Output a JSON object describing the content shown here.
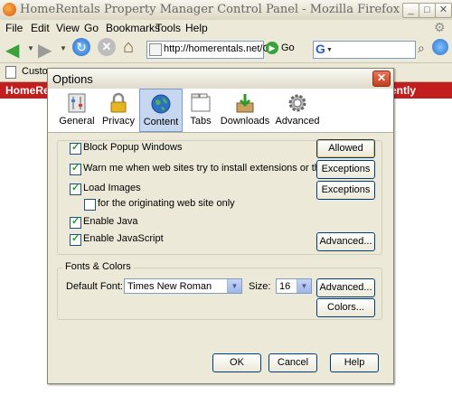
{
  "window": {
    "title": "HomeRentals Property Manager Control Panel - Mozilla Firefox",
    "min": "_",
    "max": "□",
    "close": "✕"
  },
  "menu": [
    "File",
    "Edit",
    "View",
    "Go",
    "Bookmarks",
    "Tools",
    "Help"
  ],
  "nav": {
    "url": "http://homerentals.net/Cor",
    "go_label": "Go",
    "search_value": ""
  },
  "bookmarks": {
    "item": "Custom"
  },
  "page": {
    "brand": "HomeRental",
    "logged_text": "ently logged"
  },
  "dialog": {
    "title": "Options",
    "close": "✕",
    "tabs": [
      {
        "label": "General",
        "icon": "general-sliders-icon"
      },
      {
        "label": "Privacy",
        "icon": "padlock-icon"
      },
      {
        "label": "Content",
        "icon": "globe-icon",
        "selected": true
      },
      {
        "label": "Tabs",
        "icon": "tabs-window-icon"
      },
      {
        "label": "Downloads",
        "icon": "download-box-icon"
      },
      {
        "label": "Advanced",
        "icon": "gear-icon"
      }
    ],
    "content": {
      "block_popups": "Block Popup Windows",
      "warn_extensions": "Warn me when web sites try to install extensions or themes",
      "load_images": "Load Images",
      "originating_only": "for the originating web site only",
      "enable_java": "Enable Java",
      "enable_js": "Enable JavaScript",
      "allowed_sites_btn": "Allowed Sites",
      "exceptions_btn_1": "Exceptions",
      "exceptions_btn_2": "Exceptions",
      "advanced_js_btn": "Advanced..."
    },
    "fonts": {
      "legend": "Fonts & Colors",
      "default_font_label": "Default Font:",
      "default_font_value": "Times New Roman",
      "size_label": "Size:",
      "size_value": "16",
      "advanced_btn": "Advanced...",
      "colors_btn": "Colors..."
    },
    "footer": {
      "ok": "OK",
      "cancel": "Cancel",
      "help": "Help"
    }
  }
}
